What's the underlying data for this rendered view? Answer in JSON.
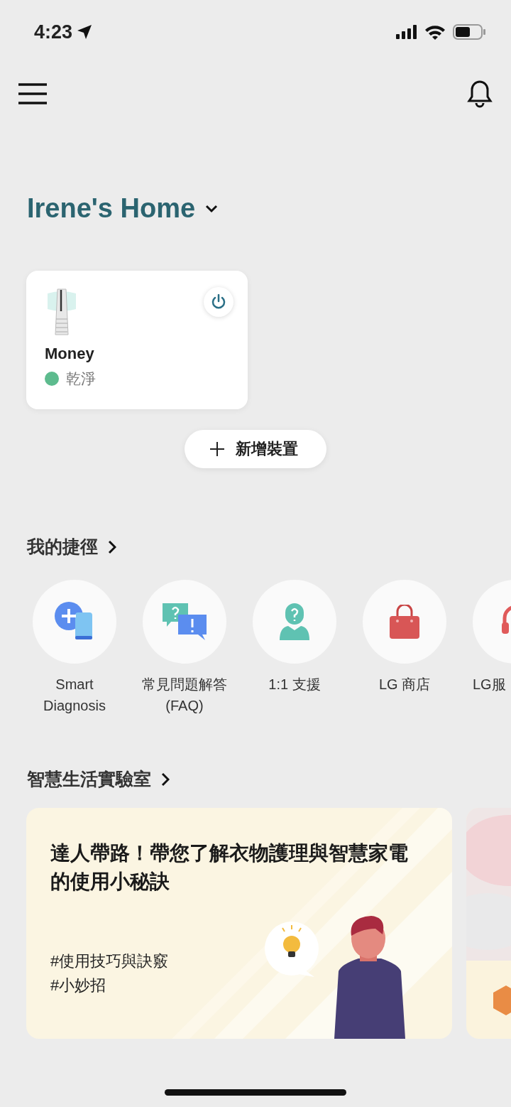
{
  "status_bar": {
    "time": "4:23"
  },
  "home": {
    "title": "Irene's Home"
  },
  "devices": [
    {
      "name": "Money",
      "status": "乾淨",
      "color": "#5dbb8e"
    }
  ],
  "add_button": {
    "label": "新增裝置"
  },
  "shortcuts": {
    "title": "我的捷徑",
    "items": [
      {
        "kind": "diagnosis",
        "label": "Smart\nDiagnosis"
      },
      {
        "kind": "faq",
        "label": "常見問題解答\n(FAQ)"
      },
      {
        "kind": "support",
        "label": "1:1 支援"
      },
      {
        "kind": "store",
        "label": "LG 商店"
      },
      {
        "kind": "service",
        "label": "LG服"
      }
    ]
  },
  "lab": {
    "title": "智慧生活實驗室",
    "cards": [
      {
        "kind": "article",
        "title": "達人帶路！帶您了解衣物護理與智慧家電的使用小秘訣",
        "tags": [
          "#使用技巧與訣竅",
          "#小妙招"
        ]
      },
      {
        "kind": "picture"
      }
    ]
  }
}
